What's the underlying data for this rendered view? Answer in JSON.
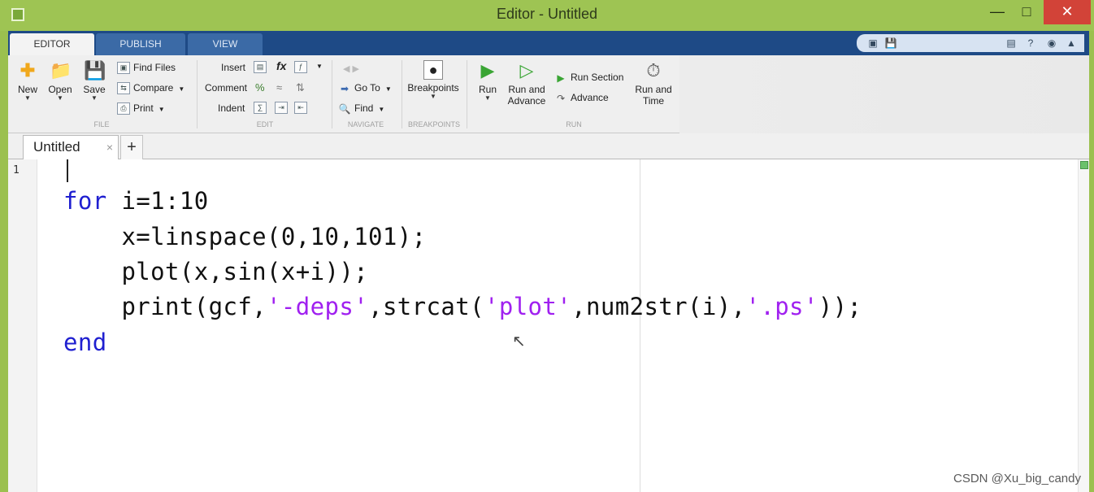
{
  "window": {
    "title": "Editor - Untitled",
    "minimize": "—",
    "maximize": "□",
    "close": "✕"
  },
  "ribbon_tabs": [
    {
      "label": "EDITOR",
      "active": true
    },
    {
      "label": "PUBLISH",
      "active": false
    },
    {
      "label": "VIEW",
      "active": false
    }
  ],
  "quick_access": [
    "undock-icon",
    "save-icon",
    "layout-icon",
    "help-icon",
    "options-icon",
    "collapse-ribbon-icon"
  ],
  "ribbon": {
    "file": {
      "section_label": "FILE",
      "new": "New",
      "open": "Open",
      "save": "Save",
      "find_files": "Find Files",
      "compare": "Compare",
      "print": "Print"
    },
    "edit": {
      "section_label": "EDIT",
      "insert": "Insert",
      "comment": "Comment",
      "indent": "Indent"
    },
    "navigate": {
      "section_label": "NAVIGATE",
      "go_to": "Go To",
      "find": "Find"
    },
    "breakpoints": {
      "section_label": "BREAKPOINTS",
      "breakpoints": "Breakpoints"
    },
    "run": {
      "section_label": "RUN",
      "run": "Run",
      "run_and_advance_1": "Run and",
      "run_and_advance_2": "Advance",
      "run_section": "Run Section",
      "advance": "Advance",
      "run_and_time_1": "Run and",
      "run_and_time_2": "Time"
    }
  },
  "document_tabs": [
    {
      "label": "Untitled"
    }
  ],
  "add_tab": "+",
  "editor": {
    "line_number": "1",
    "lines": {
      "l2_kw": "for",
      "l2_rest": " i=1:10",
      "l3": "    x=linspace(0,10,101);",
      "l4": "    plot(x,sin(x+i));",
      "l5_a": "    print(gcf,",
      "l5_s1": "'-deps'",
      "l5_b": ",strcat(",
      "l5_s2": "'plot'",
      "l5_c": ",num2str(i),",
      "l5_s3": "'.ps'",
      "l5_d": "));",
      "l6_kw": "end"
    }
  },
  "watermark": "CSDN @Xu_big_candy"
}
